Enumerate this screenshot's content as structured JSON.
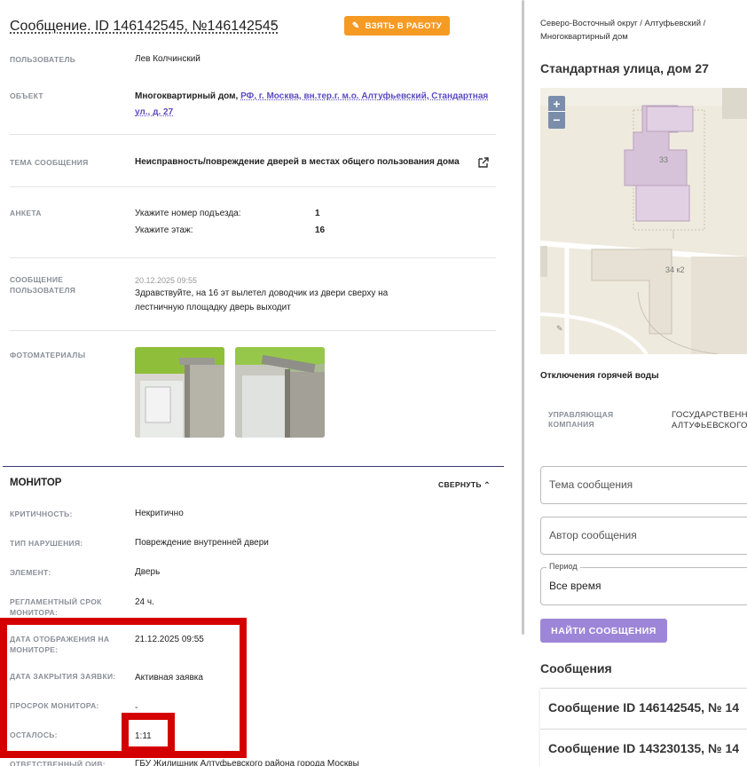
{
  "header": {
    "title": "Сообщение. ID 146142545, №146142545",
    "take_button": "ВЗЯТЬ В РАБОТУ"
  },
  "details": {
    "user_label": "ПОЛЬЗОВАТЕЛЬ",
    "user_value": "Лев Колчинский",
    "object_label": "ОБЪЕКТ",
    "object_type": "Многоквартирный дом,",
    "object_link_line1": "РФ, г. Москва, вн.тер.г. м.о. Алтуфьевский, Стандартная",
    "object_link_line2": "ул., д. 27",
    "topic_label": "ТЕМА СООБЩЕНИЯ",
    "topic_value": "Неисправность/повреждение дверей в местах общего пользования дома",
    "survey_label": "АНКЕТА",
    "survey_q1": "Укажите номер подъезда:",
    "survey_a1": "1",
    "survey_q2": "Укажите этаж:",
    "survey_a2": "16",
    "user_msg_label_1": "СООБЩЕНИЕ",
    "user_msg_label_2": "ПОЛЬЗОВАТЕЛЯ",
    "user_msg_date": "20.12.2025 09:55",
    "user_msg_line1": "Здравствуйте, на 16 эт вылетел доводчик из двери сверху на",
    "user_msg_line2": "лестничную площадку дверь выходит",
    "photos_label": "ФОТОМАТЕРИАЛЫ"
  },
  "monitor": {
    "title": "МОНИТОР",
    "collapse": "СВЕРНУТЬ",
    "criticality_label": "КРИТИЧНОСТЬ:",
    "criticality_value": "Некритично",
    "violation_label": "ТИП НАРУШЕНИЯ:",
    "violation_value": "Повреждение внутренней двери",
    "element_label": "ЭЛЕМЕНТ:",
    "element_value": "Дверь",
    "deadline_label_1": "РЕГЛАМЕНТНЫЙ СРОК",
    "deadline_label_2": "МОНИТОРА:",
    "deadline_value": "24 ч.",
    "display_date_label_1": "ДАТА ОТОБРАЖЕНИЯ НА",
    "display_date_label_2": "МОНИТОРЕ:",
    "display_date_value": "21.12.2025 09:55",
    "close_date_label": "ДАТА ЗАКРЫТИЯ ЗАЯВКИ:",
    "close_date_value": "Активная заявка",
    "overdue_label": "ПРОСРОК МОНИТОРА:",
    "overdue_value": "-",
    "remaining_label": "ОСТАЛОСЬ:",
    "remaining_value": "1:11",
    "responsible_label": "ОТВЕТСТВЕННЫЙ ОИВ:",
    "responsible_value": "ГБУ Жилищник Алтуфьевского района города Москвы"
  },
  "right": {
    "breadcrumb_1": "Северо-Восточный округ / Алтуфьевский /",
    "breadcrumb_2": "Многоквартирный дом",
    "address": "Стандартная улица, дом 27",
    "map_label_33": "33",
    "map_label_34": "34 к2",
    "hot_water": "Отключения горячей воды",
    "uk_label_1": "УПРАВЛЯЮЩАЯ",
    "uk_label_2": "КОМПАНИЯ",
    "uk_value_1": "ГОСУДАРСТВЕНН",
    "uk_value_2": "АЛТУФЬЕВСКОГО",
    "topic_placeholder": "Тема сообщения",
    "author_placeholder": "Автор сообщения",
    "period_label": "Период",
    "period_value": "Все время",
    "find_button": "НАЙТИ СООБЩЕНИЯ",
    "messages_title": "Сообщения",
    "message_1": "Сообщение ID 146142545, № 14",
    "message_2": "Сообщение ID 143230135, № 14"
  },
  "colors": {
    "accent_orange": "#f59a23",
    "accent_purple": "#9d86d8",
    "link_purple": "#5b4bc4",
    "highlight_red": "#d40000"
  }
}
